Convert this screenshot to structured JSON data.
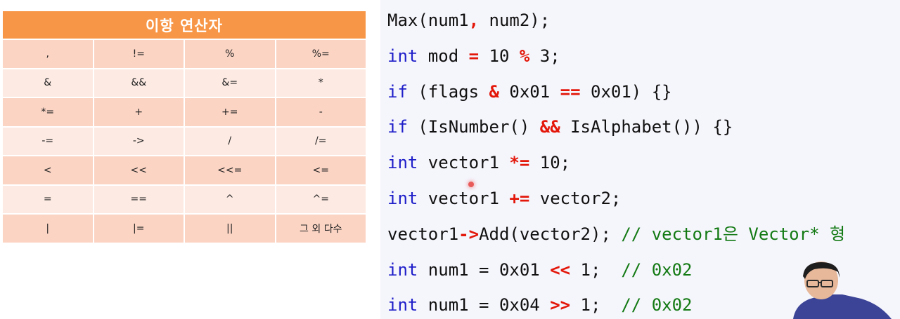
{
  "table": {
    "title": "이항 연산자",
    "rows": [
      [
        ",",
        "!=",
        "%",
        "%="
      ],
      [
        "&",
        "&&",
        "&=",
        "*"
      ],
      [
        "*=",
        "+",
        "+=",
        "-"
      ],
      [
        "-=",
        "->",
        "/",
        "/="
      ],
      [
        "<",
        "<<",
        "<<=",
        "<="
      ],
      [
        "=",
        "==",
        "^",
        "^="
      ],
      [
        "|",
        "|=",
        "||",
        "그 외 다수"
      ]
    ]
  },
  "code": [
    [
      {
        "t": "Max(num1",
        "c": "tx"
      },
      {
        "t": ",",
        "c": "op"
      },
      {
        "t": " num2);",
        "c": "tx"
      }
    ],
    [
      {
        "t": "int",
        "c": "kw"
      },
      {
        "t": " mod ",
        "c": "tx"
      },
      {
        "t": "=",
        "c": "op"
      },
      {
        "t": " 10 ",
        "c": "tx"
      },
      {
        "t": "%",
        "c": "op"
      },
      {
        "t": " 3;",
        "c": "tx"
      }
    ],
    [
      {
        "t": "if",
        "c": "kw"
      },
      {
        "t": " (flags ",
        "c": "tx"
      },
      {
        "t": "&",
        "c": "op"
      },
      {
        "t": " 0x01 ",
        "c": "tx"
      },
      {
        "t": "==",
        "c": "op"
      },
      {
        "t": " 0x01) {}",
        "c": "tx"
      }
    ],
    [
      {
        "t": "if",
        "c": "kw"
      },
      {
        "t": " (IsNumber() ",
        "c": "tx"
      },
      {
        "t": "&&",
        "c": "op"
      },
      {
        "t": " IsAlphabet()) {}",
        "c": "tx"
      }
    ],
    [
      {
        "t": "int",
        "c": "kw"
      },
      {
        "t": " vector1 ",
        "c": "tx"
      },
      {
        "t": "*=",
        "c": "op"
      },
      {
        "t": " 10;",
        "c": "tx"
      }
    ],
    [
      {
        "t": "int",
        "c": "kw"
      },
      {
        "t": " vector1 ",
        "c": "tx"
      },
      {
        "t": "+=",
        "c": "op"
      },
      {
        "t": " vector2;",
        "c": "tx"
      }
    ],
    [
      {
        "t": "vector1",
        "c": "tx"
      },
      {
        "t": "->",
        "c": "op"
      },
      {
        "t": "Add(vector2); ",
        "c": "tx"
      },
      {
        "t": "// vector1은 Vector* 형",
        "c": "cm"
      }
    ],
    [
      {
        "t": "int",
        "c": "kw"
      },
      {
        "t": " num1 = 0x01 ",
        "c": "tx"
      },
      {
        "t": "<<",
        "c": "op"
      },
      {
        "t": " 1;  ",
        "c": "tx"
      },
      {
        "t": "// 0x02",
        "c": "cm"
      }
    ],
    [
      {
        "t": "int",
        "c": "kw"
      },
      {
        "t": " num1 = 0x04 ",
        "c": "tx"
      },
      {
        "t": ">>",
        "c": "op"
      },
      {
        "t": " 1;  ",
        "c": "tx"
      },
      {
        "t": "// 0x02",
        "c": "cm"
      }
    ]
  ],
  "colors": {
    "header": "#f79646",
    "row_dark": "#fbd4c4",
    "row_light": "#fdeae3",
    "keyword": "#1f1fc9",
    "operator": "#e3170a",
    "comment": "#137a13"
  }
}
